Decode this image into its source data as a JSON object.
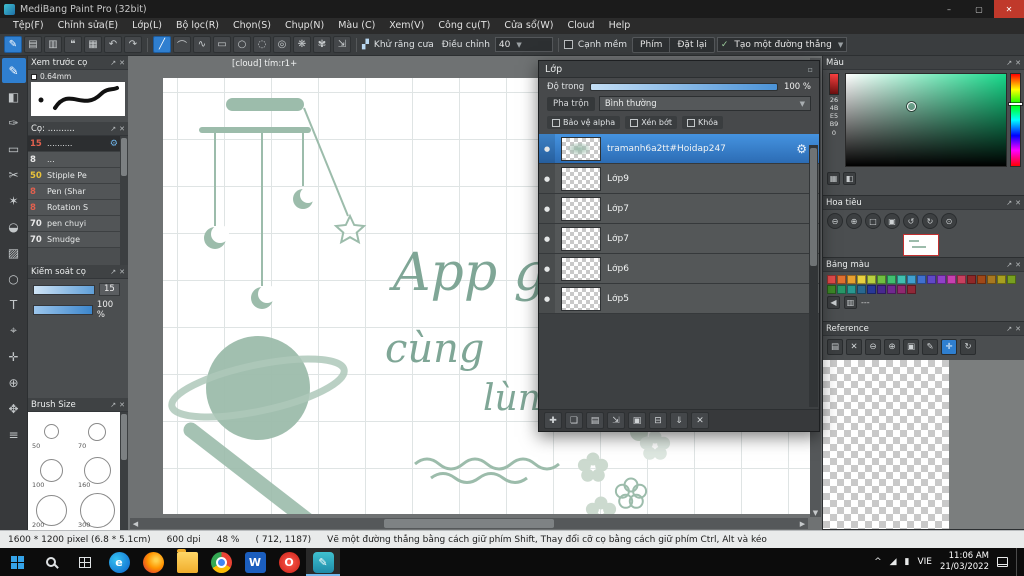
{
  "window": {
    "title": "MediBang Paint Pro (32bit)",
    "minimize_glyph": "–",
    "maximize_glyph": "▢",
    "close_glyph": "✕"
  },
  "menu": {
    "items": [
      "Tệp(F)",
      "Chỉnh sửa(E)",
      "Lớp(L)",
      "Bộ lọc(R)",
      "Chọn(S)",
      "Chụp(N)",
      "Màu (C)",
      "Xem(V)",
      "Công cụ(T)",
      "Cửa sổ(W)",
      "Cloud",
      "Help"
    ]
  },
  "toolbar": {
    "left_icons": [
      {
        "name": "new-canvas-icon",
        "glyph": "✎",
        "cls": "accent"
      },
      {
        "name": "save-icon",
        "glyph": "▤"
      },
      {
        "name": "export-icon",
        "glyph": "▥"
      },
      {
        "name": "comment-icon",
        "glyph": "❝"
      },
      {
        "name": "material-grid-icon",
        "glyph": "▦"
      },
      {
        "name": "undo-icon",
        "glyph": "↶"
      },
      {
        "name": "redo-icon",
        "glyph": "↷"
      }
    ],
    "shape_tools": [
      {
        "name": "straight-line-tool",
        "glyph": "╱",
        "selected": true
      },
      {
        "name": "curve-tool",
        "glyph": "⌒"
      },
      {
        "name": "polyline-tool",
        "glyph": "∿"
      },
      {
        "name": "rect-tool",
        "glyph": "▭"
      },
      {
        "name": "ellipse-tool",
        "glyph": "○"
      },
      {
        "name": "dash-line-tool",
        "glyph": "◌"
      },
      {
        "name": "spiral-tool",
        "glyph": "◎"
      },
      {
        "name": "rosette-tool",
        "glyph": "❋"
      },
      {
        "name": "symmetry-tool",
        "glyph": "✾"
      },
      {
        "name": "expand-tool",
        "glyph": "⇲"
      }
    ],
    "anti_alias_label": "Khử răng cưa",
    "adjust_label": "Điều chỉnh",
    "adjust_value": "40",
    "soft_edge_label": "Cạnh mềm",
    "key_button": "Phím",
    "reset_button": "Đặt lại",
    "line_mode_check": "✓",
    "line_mode_value": "Tạo một đường thẳng"
  },
  "tools": {
    "items": [
      {
        "name": "pen-tool",
        "glyph": "✎",
        "selected": true
      },
      {
        "name": "eraser-tool",
        "glyph": "◧"
      },
      {
        "name": "pencil-tool",
        "glyph": "✑"
      },
      {
        "name": "select-tool",
        "glyph": "▭"
      },
      {
        "name": "lasso-tool",
        "glyph": "✂"
      },
      {
        "name": "magic-wand-tool",
        "glyph": "✶"
      },
      {
        "name": "bucket-tool",
        "glyph": "◒"
      },
      {
        "name": "gradient-tool",
        "glyph": "▨"
      },
      {
        "name": "shape-tool",
        "glyph": "○"
      },
      {
        "name": "text-tool",
        "glyph": "T"
      },
      {
        "name": "eyedropper-tool",
        "glyph": "⌖"
      },
      {
        "name": "move-tool",
        "glyph": "✛"
      },
      {
        "name": "zoom-tool",
        "glyph": "⊕"
      },
      {
        "name": "hand-tool",
        "glyph": "✥"
      },
      {
        "name": "divide-tool",
        "glyph": "≡"
      }
    ]
  },
  "left": {
    "brush_preview": {
      "title": "Xem trước cọ",
      "size_label": "0.64mm"
    },
    "brush_list": {
      "title": "Cọ: ..........",
      "items": [
        {
          "size": "15",
          "name": "..........",
          "color": "#e0604e",
          "selected": true
        },
        {
          "size": "8",
          "name": "...",
          "color": "#e8e8e8"
        },
        {
          "size": "50",
          "name": "Stipple Pe",
          "color": "#e8c23a"
        },
        {
          "size": "8",
          "name": "Pen (Shar",
          "color": "#e0604e"
        },
        {
          "size": "8",
          "name": "Rotation S",
          "color": "#e0604e"
        },
        {
          "size": "70",
          "name": "pen chuyi",
          "color": "#e8e8e8"
        },
        {
          "size": "70",
          "name": "Smudge",
          "color": "#e8e8e8"
        }
      ]
    },
    "brush_control": {
      "title": "Kiểm soát cọ",
      "size_value": "15",
      "opacity_value": "100 %"
    },
    "brush_size": {
      "title": "Brush Size",
      "sizes": [
        "50",
        "70",
        "100",
        "160",
        "200",
        "300"
      ]
    }
  },
  "canvas": {
    "tab": "[cloud] tím:r1+",
    "texts": [
      "App g",
      "cùng",
      "lùn"
    ]
  },
  "layers_panel": {
    "title": "Lớp",
    "opacity_label": "Độ trong",
    "opacity_value": "100 %",
    "blend_label": "Pha trộn",
    "blend_value": "Bình thường",
    "checkboxes": [
      "Bảo vệ alpha",
      "Xén bớt",
      "Khóa"
    ],
    "layers": [
      {
        "name": "tramanh6a2tt#Hoidap247",
        "selected": true
      },
      {
        "name": "Lớp9"
      },
      {
        "name": "Lớp7"
      },
      {
        "name": "Lớp7"
      },
      {
        "name": "Lớp6"
      },
      {
        "name": "Lớp5"
      }
    ],
    "tools": [
      {
        "name": "add-layer-icon",
        "glyph": "✚"
      },
      {
        "name": "duplicate-layer-icon",
        "glyph": "❏"
      },
      {
        "name": "layer-material-icon",
        "glyph": "▤"
      },
      {
        "name": "transfer-layer-icon",
        "glyph": "⇲"
      },
      {
        "name": "layer-folder-icon",
        "glyph": "▣"
      },
      {
        "name": "combine-layers-icon",
        "glyph": "⊟"
      },
      {
        "name": "merge-down-icon",
        "glyph": "⇓"
      },
      {
        "name": "delete-layer-icon",
        "glyph": "✕"
      }
    ]
  },
  "right": {
    "color": {
      "title": "Màu",
      "values": [
        "26",
        "4B",
        "E5",
        "B9",
        "0"
      ],
      "current_hex": "#4BE5B9"
    },
    "navigator": {
      "title": "Hoa tiêu",
      "buttons": [
        {
          "name": "zoom-out-icon",
          "glyph": "⊖"
        },
        {
          "name": "zoom-in-icon",
          "glyph": "⊕"
        },
        {
          "name": "fit-window-icon",
          "glyph": "□"
        },
        {
          "name": "actual-size-icon",
          "glyph": "▣"
        },
        {
          "name": "rotate-left-icon",
          "glyph": "↺"
        },
        {
          "name": "rotate-right-icon",
          "glyph": "↻"
        },
        {
          "name": "reset-view-icon",
          "glyph": "⊙"
        }
      ]
    },
    "palette": {
      "title": "Bảng màu",
      "footer_label": "---",
      "swatches": [
        "#e04a4a",
        "#e07030",
        "#e8a030",
        "#e8d040",
        "#b8d040",
        "#70c040",
        "#40c070",
        "#40c0b0",
        "#40a0d0",
        "#4070d0",
        "#6048c8",
        "#9040c8",
        "#c840b0",
        "#c84060",
        "#902828",
        "#a04818",
        "#a87820",
        "#a8a020",
        "#78a020",
        "#3c8828",
        "#289868",
        "#289890",
        "#286890",
        "#283898",
        "#482890",
        "#702890",
        "#902870",
        "#902838"
      ]
    },
    "reference": {
      "title": "Reference",
      "buttons": [
        {
          "name": "open-reference-icon",
          "glyph": "▤"
        },
        {
          "name": "close-reference-icon",
          "glyph": "✕"
        },
        {
          "name": "ref-zoom-out-icon",
          "glyph": "⊖"
        },
        {
          "name": "ref-zoom-in-icon",
          "glyph": "⊕"
        },
        {
          "name": "ref-fit-icon",
          "glyph": "▣"
        },
        {
          "name": "ref-eyedropper-icon",
          "glyph": "✎"
        },
        {
          "name": "ref-hand-icon",
          "glyph": "✛",
          "selected": true
        },
        {
          "name": "ref-rotate-icon",
          "glyph": "↻"
        }
      ]
    }
  },
  "statusbar": {
    "size": "1600 * 1200 pixel  (6.8 * 5.1cm)",
    "dpi": "600 dpi",
    "zoom": "48 %",
    "coords": "( 712, 1187)",
    "hint": "Vẽ một đường thẳng bằng cách giữ phím Shift, Thay đổi cỡ cọ bằng cách giữ phím Ctrl, Alt và kéo"
  },
  "taskbar": {
    "apps": [
      {
        "name": "edge-icon",
        "cls": "app-edge",
        "label": "e"
      },
      {
        "name": "firefox-icon",
        "cls": "app-firefox"
      },
      {
        "name": "explorer-icon",
        "cls": "app-explorer"
      },
      {
        "name": "chrome-icon",
        "cls": "app-chrome"
      },
      {
        "name": "word-icon",
        "cls": "app-word",
        "label": "W"
      },
      {
        "name": "opera-icon",
        "cls": "app-opera",
        "label": "O"
      },
      {
        "name": "medibang-icon",
        "cls": "app-medibang",
        "label": "✎",
        "active": true
      }
    ],
    "tray": {
      "chevron": "^",
      "network_glyph": "◢",
      "battery_glyph": "▮",
      "lang": "VIE",
      "time": "11:06 AM",
      "date": "21/03/2022"
    }
  }
}
